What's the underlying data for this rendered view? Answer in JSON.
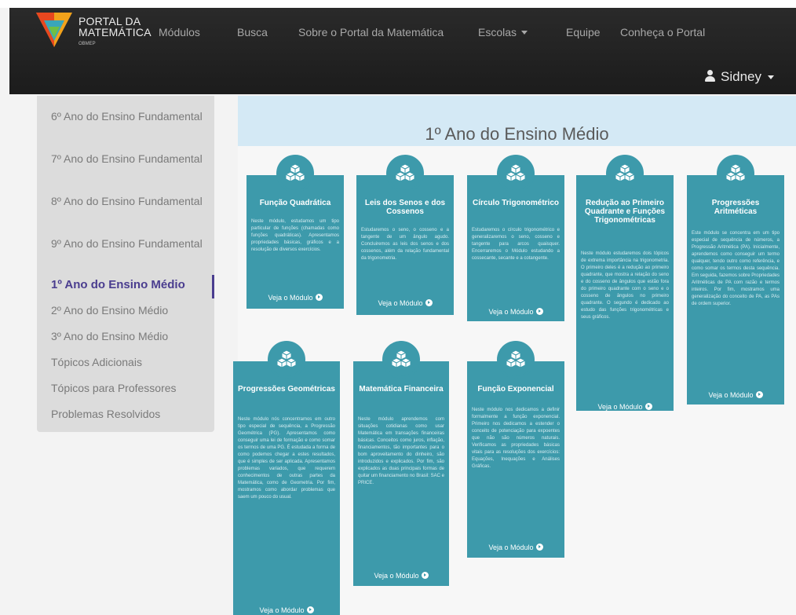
{
  "brand": {
    "line1": "PORTAL DA",
    "line2": "MATEMÁTICA",
    "line3": "OBMEP"
  },
  "nav": {
    "items": [
      "Módulos",
      "Busca",
      "Sobre o Portal da Matemática",
      "Escolas",
      "Equipe",
      "Conheça o Portal"
    ]
  },
  "user": {
    "name": "Sidney"
  },
  "sidebar": {
    "items": [
      "6º Ano do Ensino Fundamental",
      "7º Ano do Ensino Fundamental",
      "8º Ano do Ensino Fundamental",
      "9º Ano do Ensino Fundamental",
      "1º Ano do Ensino Médio",
      "2º Ano do Ensino Médio",
      "3º Ano do Ensino Médio",
      "Tópicos Adicionais",
      "Tópicos para Professores",
      "Problemas Resolvidos"
    ],
    "active_index": 4
  },
  "main": {
    "title": "1º Ano do Ensino Médio"
  },
  "link_label": "Veja o Módulo",
  "colors": {
    "card": "#3d9aab",
    "header_bg": "#d4e9f5",
    "navbar": "#1f1f1f",
    "active": "#4a3d8f"
  },
  "cards": [
    {
      "title": "Função Quadrática",
      "desc": "Neste módulo, estudamos um tipo particular de funções (chamadas como funções quadráticas). Apresentamos propriedades básicas, gráficos e a resolução de diversos exercícios."
    },
    {
      "title": "Leis dos Senos e dos Cossenos",
      "desc": "Estudaremos o seno, o cosseno e a tangente de um ângulo agudo. Concluiremos as leis dos senos e dos cossenos, além da relação fundamental da trigonometria."
    },
    {
      "title": "Círculo Trigonométrico",
      "desc": "Estudaremos o círculo trigonométrico e generalizaremos o seno, cosseno e tangente para arcos quaisquer. Encerraremos o Módulo estudando a cossecante, secante e a cotangente."
    },
    {
      "title": "Redução ao Primeiro Quadrante e Funções Trigonométricas",
      "desc": "Neste módulo estudaremos dois tópicos de extrema importância na trigonometria. O primeiro deles é a redução ao primeiro quadrante, que mostra a relação do seno e do cosseno de ângulos que estão fora do primeiro quadrante com o seno e o cosseno de ângulos no primeiro quadrante. O segundo é dedicado ao estudo das funções trigonométricas e seus gráficos."
    },
    {
      "title": "Progressões Aritméticas",
      "desc": "Este módulo se concentra em um tipo especial de sequência de números, a Progressão Aritmética (PA). Inicialmente, aprendemos como conseguir um termo qualquer, tendo outro como referência, e como somar os termos desta sequência. Em seguida, fazemos sobre Propriedades Aritméticas de PA com razão e termos inteiros. Por fim, mostramos uma generalização do conceito de PA, as PAs de ordem superior."
    },
    {
      "title": "Progressões Geométricas",
      "desc": "Neste módulo nós concentramos em outro tipo especial de sequência, a Progressão Geométrica (PG). Apresentamos como conseguir uma lei de formação e como somar os termos de uma PG. É estudada a forma de como podemos chegar a estes resultados, que é simples de ser aplicada. Apresentamos problemas variados, que requerem conhecimentos de outras partes da Matemática, como de Geometria. Por fim, mostramos como abordar problemas que saem um pouco do usual."
    },
    {
      "title": "Matemática Financeira",
      "desc": "Neste módulo aprendemos com situações cotidianas como usar Matemática em transações financeiras básicas. Conceitos como juros, inflação, financiamentos, tão importantes para o bom aproveitamento do dinheiro, são introduzidos e explicados. Por fim, são explicados as duas principais formas de quitar um financiamento no Brasil: SAC e PRICE."
    },
    {
      "title": "Função Exponencial",
      "desc": "Neste módulo nos dedicamos a definir formalmente a função exponencial. Primeiro nos dedicamos a estender o conceito de potenciação para expoentes que não são números naturais. Verificamos as propriedades básicas vitais para as resoluções dos exercícios: Equações, Inequações e Análises Gráficas."
    }
  ]
}
